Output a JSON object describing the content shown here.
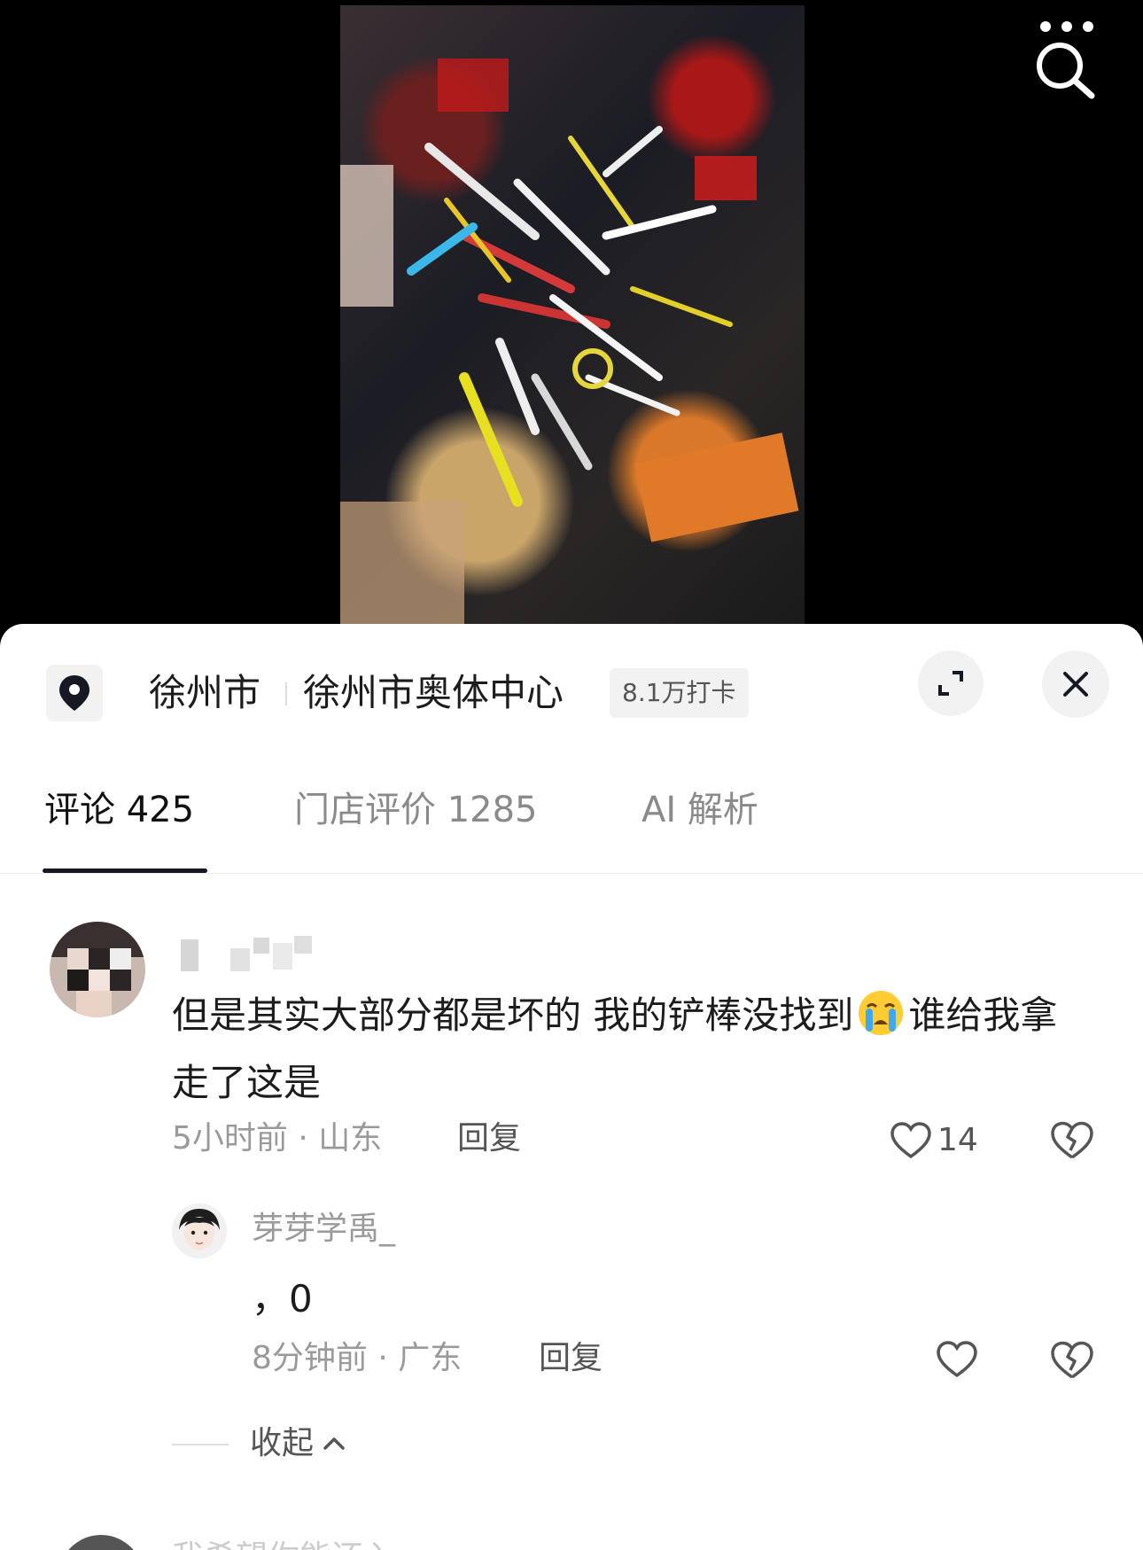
{
  "video": {
    "more_icon": "more-dots-icon",
    "search_icon": "search-icon"
  },
  "location": {
    "icon": "location-pin-icon",
    "city": "徐州市",
    "venue": "徐州市奥体中心",
    "checkins": "8.1万打卡"
  },
  "header_actions": {
    "expand_icon": "expand-icon",
    "close_icon": "close-icon"
  },
  "tabs": [
    {
      "label": "评论 425",
      "active": true
    },
    {
      "label": "门店评价 1285",
      "active": false
    },
    {
      "label": "AI 解析",
      "active": false
    }
  ],
  "comment": {
    "text_before_emoji": "但是其实大部分都是坏的 我的铲棒没找到",
    "emoji": "crying-emoji",
    "text_after_emoji": "谁给我拿走了这是",
    "time_location": "5小时前 · 山东",
    "reply_label": "回复",
    "like_count": "14"
  },
  "reply": {
    "username": "芽芽学禹_",
    "text": "，0",
    "time_location": "8分钟前 · 广东",
    "reply_label": "回复"
  },
  "collapse_label": "收起",
  "next_comment_text": "我希望你能还入"
}
